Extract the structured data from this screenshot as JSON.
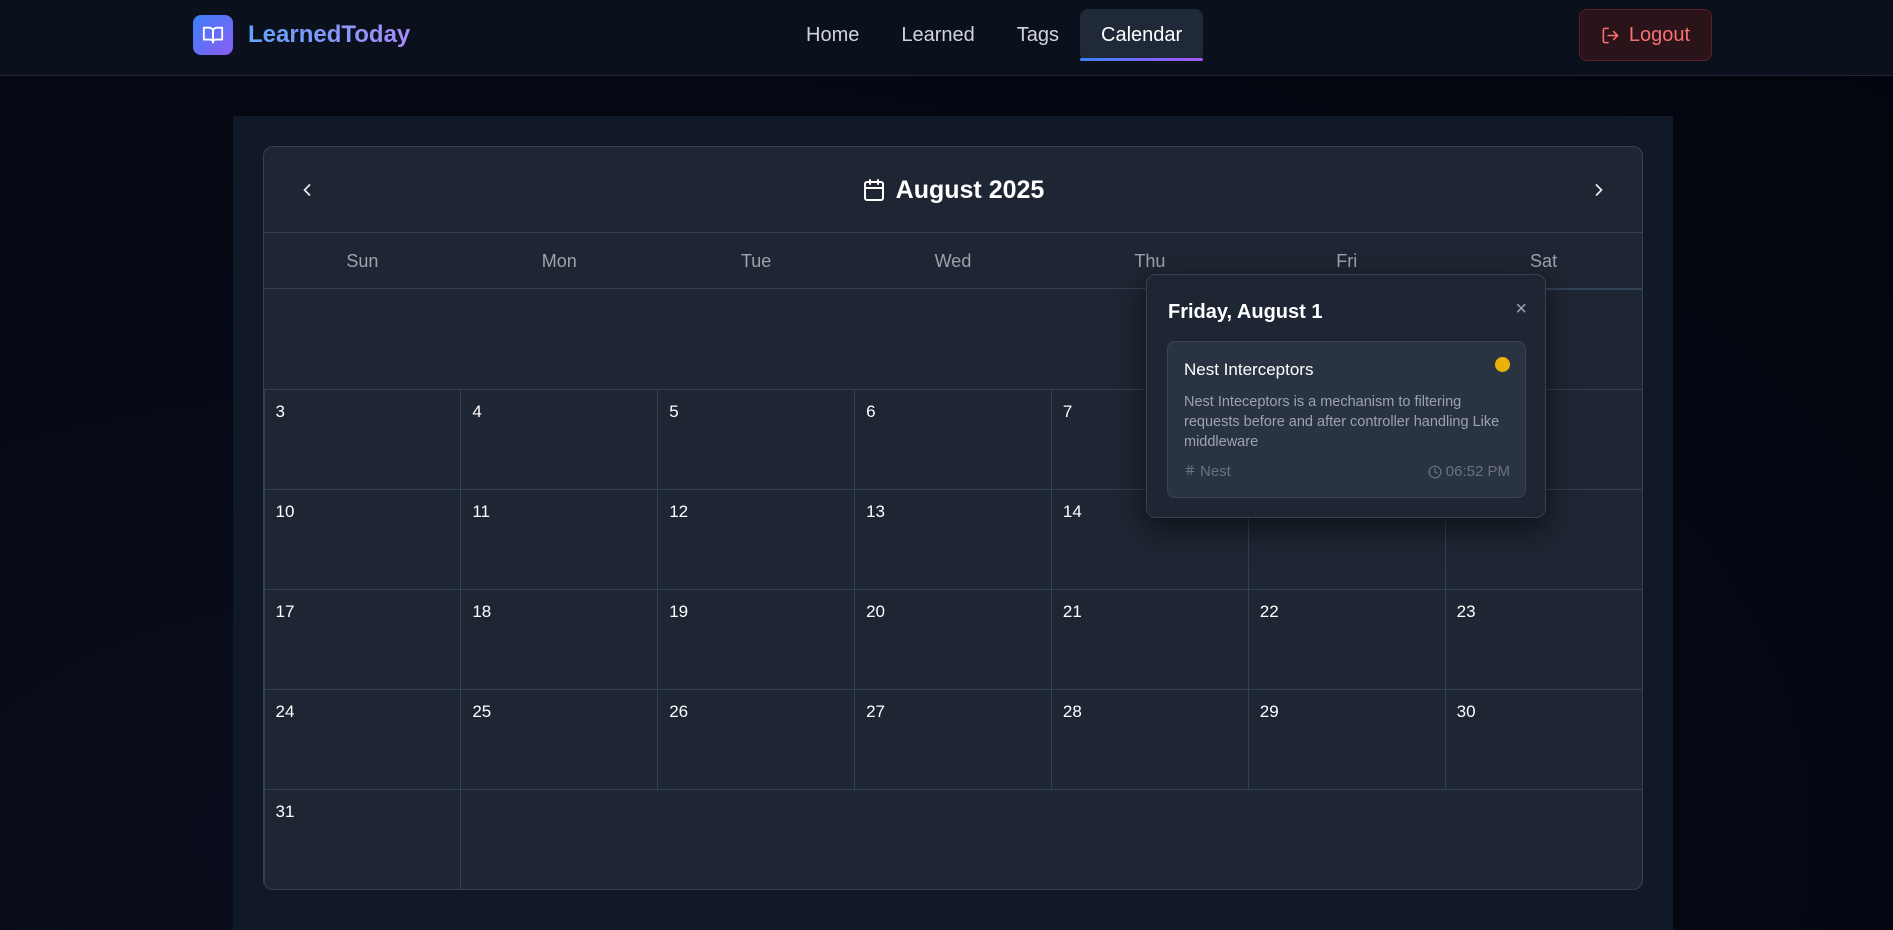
{
  "app": {
    "name": "LearnedToday",
    "brand_icon": "open-book-icon",
    "accent_start": "#3b82f6",
    "accent_end": "#a855f7"
  },
  "nav": {
    "items": [
      {
        "label": "Home",
        "active": false
      },
      {
        "label": "Learned",
        "active": false
      },
      {
        "label": "Tags",
        "active": false
      },
      {
        "label": "Calendar",
        "active": true
      }
    ],
    "logout_label": "Logout",
    "logout_icon": "logout-icon",
    "logout_color": "#f87171"
  },
  "calendar": {
    "month_label": "August 2025",
    "title_icon": "calendar-icon",
    "prev_icon": "chevron-left-icon",
    "next_icon": "chevron-right-icon",
    "weekdays": [
      "Sun",
      "Mon",
      "Tue",
      "Wed",
      "Thu",
      "Fri",
      "Sat"
    ],
    "first_weekday_index": 5,
    "days_in_month": 31
  },
  "popup": {
    "date_label": "Friday, August 1",
    "close_glyph": "×",
    "entries": [
      {
        "title": "Nest Interceptors",
        "description": "Nest Inteceptors is a mechanism to filtering requests before and after controller handling Like middleware",
        "tag": "Nest",
        "tag_icon": "hash-icon",
        "time": "06:52 PM",
        "time_icon": "clock-icon",
        "dot_color": "#eab308"
      }
    ]
  }
}
